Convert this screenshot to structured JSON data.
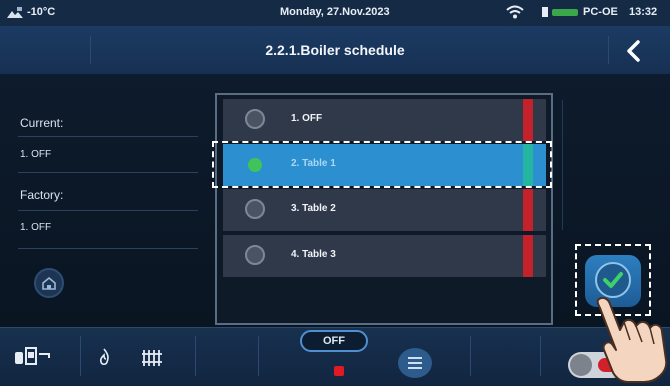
{
  "status_bar": {
    "temperature": "-10°C",
    "date": "Monday, 27.Nov.2023",
    "device": "PC-OE",
    "time": "13:32"
  },
  "header": {
    "title": "2.2.1.Boiler schedule"
  },
  "left_panel": {
    "current_label": "Current:",
    "current_value": "1. OFF",
    "factory_label": "Factory:",
    "factory_value": "1. OFF"
  },
  "options": [
    {
      "label": "1. OFF",
      "selected": false
    },
    {
      "label": "2. Table 1",
      "selected": true
    },
    {
      "label": "3. Table 2",
      "selected": false
    },
    {
      "label": "4. Table 3",
      "selected": false
    }
  ],
  "bottom_bar": {
    "mode_label": "OFF"
  },
  "colors": {
    "selected_row": "#2c8fd0",
    "status_strip_red": "#c4222b",
    "status_strip_teal": "#24b5a0",
    "radio_selected": "#3fc35a",
    "accent_blue": "#2d7fc0"
  }
}
